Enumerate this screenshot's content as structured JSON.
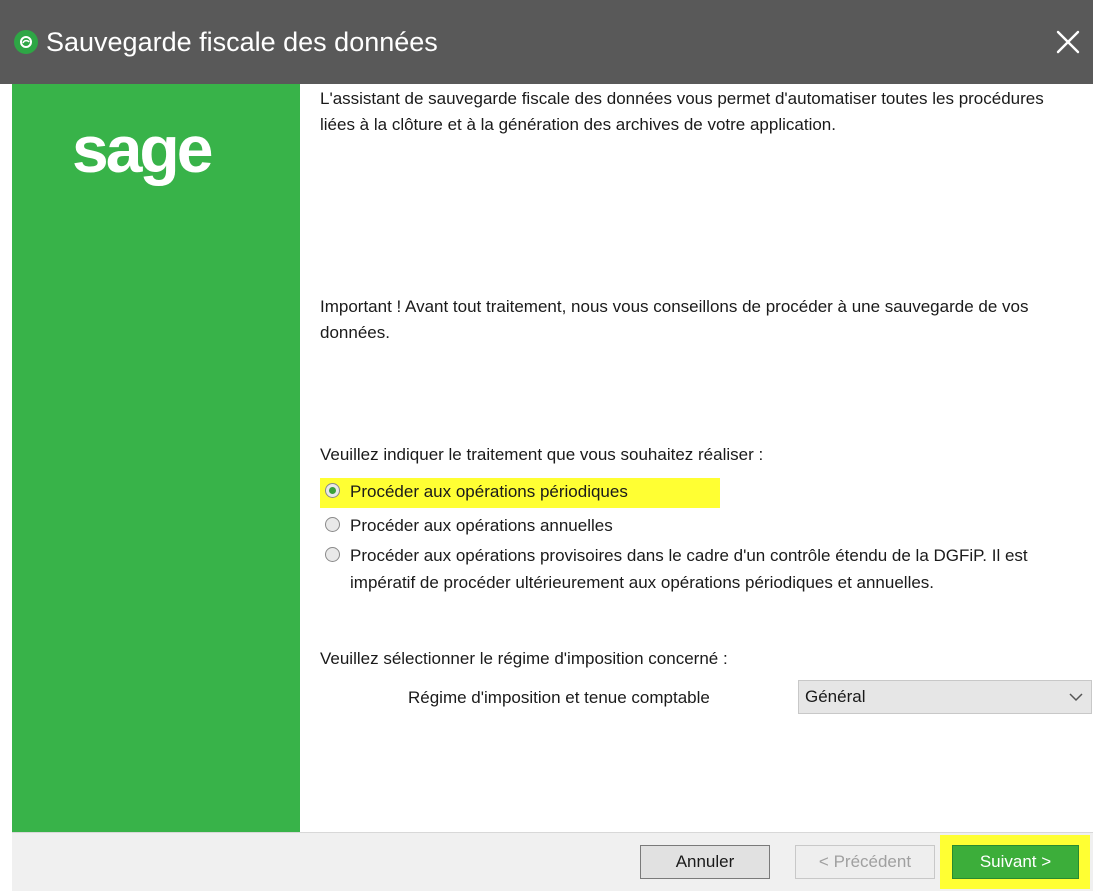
{
  "window": {
    "title": "Sauvegarde fiscale des données",
    "colors": {
      "titlebar": "#595959",
      "sidebar": "#38b349",
      "highlight": "#ffff33",
      "primary_button": "#3cae3a"
    }
  },
  "sidebar": {
    "logo": "sage"
  },
  "content": {
    "intro": "L'assistant de sauvegarde fiscale des données vous permet d'automatiser toutes les procédures liées à la clôture et à la génération des archives de votre application.",
    "important": "Important ! Avant tout traitement, nous vous conseillons de procéder à une sauvegarde de vos données.",
    "question": "Veuillez indiquer le traitement que vous souhaitez réaliser :",
    "options": [
      {
        "label": "Procéder aux opérations périodiques",
        "checked": true
      },
      {
        "label": "Procéder aux opérations annuelles",
        "checked": false
      },
      {
        "label": "Procéder aux opérations provisoires dans le cadre d'un contrôle étendu de la DGFiP. Il est impératif de procéder ultérieurement aux opérations périodiques et annuelles.",
        "checked": false
      }
    ],
    "regime_question": "Veuillez sélectionner le régime d'imposition concerné :",
    "regime_label": "Régime d'imposition et tenue comptable",
    "regime_value": "Général"
  },
  "footer": {
    "cancel": "Annuler",
    "previous": "< Précédent",
    "next": "Suivant >"
  },
  "icons": {
    "app": "sage-app-icon",
    "close": "close-icon",
    "dropdown": "chevron-down-icon"
  }
}
